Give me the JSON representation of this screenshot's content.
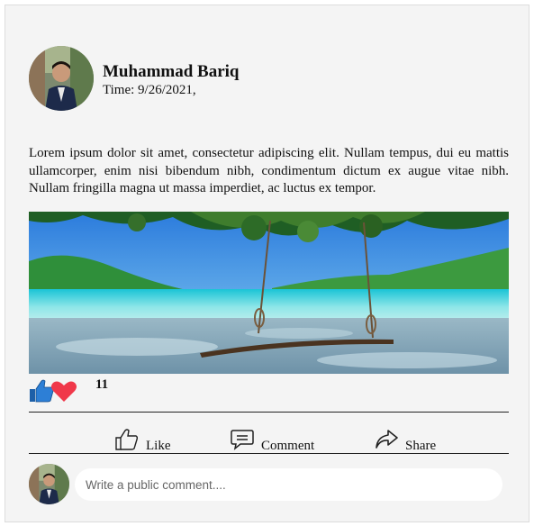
{
  "post": {
    "author": "Muhammad Bariq",
    "time": "Time: 9/26/2021,",
    "body": "Lorem ipsum dolor sit amet, consectetur adipiscing elit. Nullam tempus, dui eu mattis ullamcorper, enim nisi bibendum nibh, condimentum dictum ex augue vitae nibh. Nullam fringilla magna ut massa imperdiet, ac luctus ex tempor.",
    "reaction_count": "11"
  },
  "actions": {
    "like_label": "Like",
    "comment_label": "Comment",
    "share_label": "Share"
  },
  "comment": {
    "placeholder": "Write a public comment...."
  },
  "icons": {
    "reactions": [
      "thumbs-up-icon",
      "heart-icon"
    ],
    "actions": [
      "thumbs-up-outline-icon",
      "speech-bubble-icon",
      "share-arrow-icon"
    ]
  },
  "colors": {
    "like_blue": "#1877f2",
    "heart_red": "#f0384a",
    "card_bg": "#f4f4f4"
  }
}
